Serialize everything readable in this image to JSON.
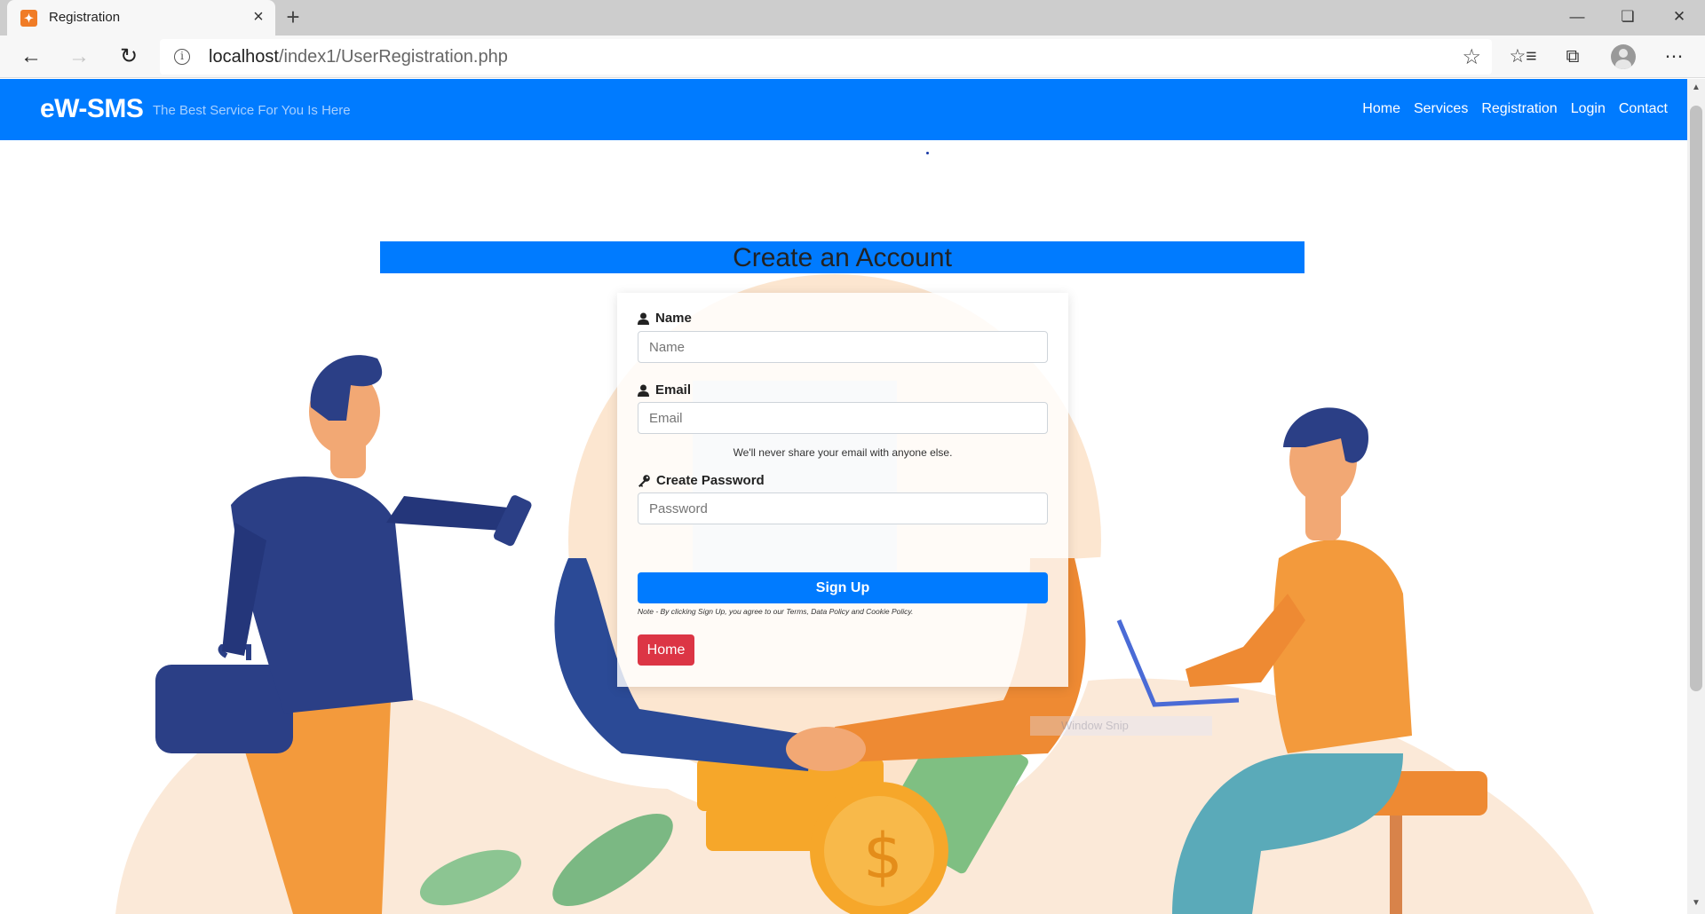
{
  "browser": {
    "tab_title": "Registration",
    "url_host": "localhost",
    "url_path": "/index1/UserRegistration.php"
  },
  "icons": {
    "favicon": "xampp-icon",
    "close": "close-icon",
    "new_tab": "plus-icon",
    "back": "back-arrow-icon",
    "forward": "forward-arrow-icon",
    "refresh": "refresh-icon",
    "info": "info-icon",
    "favorite": "star-icon",
    "favorites": "favorites-list-icon",
    "collections": "collections-icon",
    "profile": "profile-avatar-icon",
    "menu": "more-menu-icon",
    "name": "user-icon",
    "email": "user-icon",
    "password": "key-icon"
  },
  "navbar": {
    "brand": "eW-SMS",
    "tagline": "The Best Service For You Is Here",
    "links": [
      "Home",
      "Services",
      "Registration",
      "Login",
      "Contact"
    ]
  },
  "form": {
    "heading": "Create an Account",
    "name_label": "Name",
    "name_placeholder": "Name",
    "email_label": "Email",
    "email_placeholder": "Email",
    "email_help": "We'll never share your email with anyone else.",
    "password_label": "Create Password",
    "password_placeholder": "Password",
    "signup_label": "Sign Up",
    "note": "Note - By clicking Sign Up, you agree to our Terms, Data Policy and Cookie Policy.",
    "home_label": "Home"
  },
  "overlay": {
    "snip_text": "Window Snip"
  },
  "colors": {
    "primary": "#007bff",
    "danger": "#dc3545",
    "orange": "#f39a3c",
    "navy": "#2b3f86",
    "teal": "#5aaab9"
  }
}
